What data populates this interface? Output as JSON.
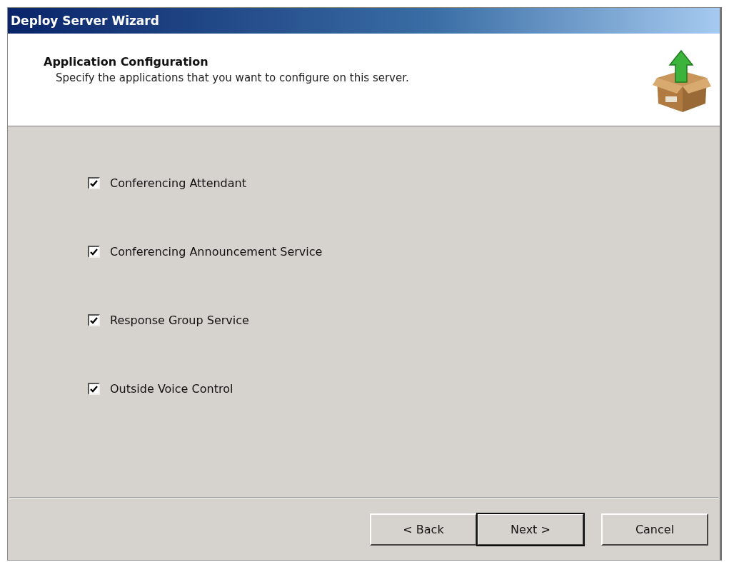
{
  "window": {
    "title": "Deploy Server Wizard"
  },
  "header": {
    "title": "Application Configuration",
    "subtitle": "Specify the applications that you want to configure on this server."
  },
  "applications": [
    {
      "label": "Conferencing Attendant",
      "checked": true
    },
    {
      "label": "Conferencing Announcement Service",
      "checked": true
    },
    {
      "label": "Response Group Service",
      "checked": true
    },
    {
      "label": "Outside Voice Control",
      "checked": true
    }
  ],
  "buttons": [
    {
      "label": "< Back",
      "default": false
    },
    {
      "label": "Next >",
      "default": true
    },
    {
      "label": "Cancel",
      "default": false
    }
  ]
}
